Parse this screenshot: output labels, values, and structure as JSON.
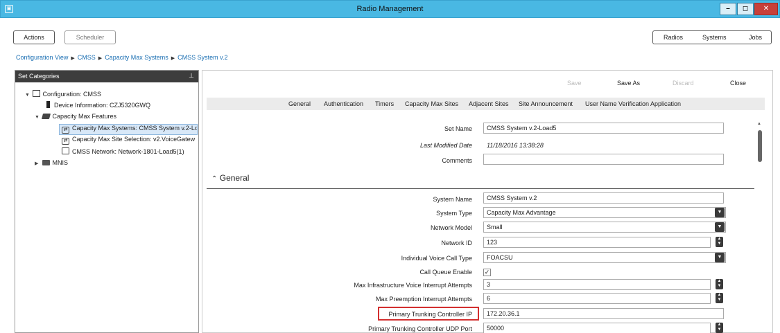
{
  "window": {
    "title": "Radio Management",
    "app_icon": "app-icon",
    "minimize": "–",
    "maximize": "◻",
    "close": "✕"
  },
  "topbar": {
    "actions": "Actions",
    "scheduler": "Scheduler",
    "nav": {
      "radios": "Radios",
      "systems": "Systems",
      "jobs": "Jobs"
    }
  },
  "breadcrumb": [
    "Configuration View",
    "CMSS",
    "Capacity Max Systems",
    "CMSS System v.2"
  ],
  "sidebar": {
    "header": "Set Categories",
    "items": [
      {
        "label": "Configuration: CMSS",
        "icon": "config-icon"
      },
      {
        "label": "Device Information: CZJ5320GWQ",
        "icon": "device-icon"
      },
      {
        "label": "Capacity Max Features",
        "icon": "folder-open-icon"
      },
      {
        "label": "Capacity Max Systems: CMSS System v.2-Lo",
        "icon": "link-icon"
      },
      {
        "label": "Capacity Max Site Selection: v2.VoiceGatew",
        "icon": "link-icon"
      },
      {
        "label": "CMSS Network: Network-1801-Load5(1)",
        "icon": "doc-icon"
      },
      {
        "label": "MNIS",
        "icon": "folder-icon"
      }
    ]
  },
  "toolbar": {
    "save": "Save",
    "save_as": "Save As",
    "discard": "Discard",
    "close": "Close"
  },
  "tabs": [
    "General",
    "Authentication",
    "Timers",
    "Capacity Max Sites",
    "Adjacent Sites",
    "Site Announcement",
    "User Name Verification Application"
  ],
  "header_fields": {
    "set_name_label": "Set Name",
    "set_name_value": "CMSS System v.2-Load5",
    "last_modified_label": "Last Modified Date",
    "last_modified_value": "11/18/2016 13:38:28",
    "comments_label": "Comments",
    "comments_value": ""
  },
  "section": {
    "title": "General",
    "chevron": "⌃"
  },
  "general": {
    "system_name_label": "System Name",
    "system_name_value": "CMSS System v.2",
    "system_type_label": "System Type",
    "system_type_value": "Capacity Max Advantage",
    "network_model_label": "Network Model",
    "network_model_value": "Small",
    "network_id_label": "Network ID",
    "network_id_value": "123",
    "ivc_type_label": "Individual Voice Call Type",
    "ivc_type_value": "FOACSU",
    "call_queue_label": "Call Queue Enable",
    "call_queue_checked": "✓",
    "max_infra_label": "Max Infrastructure Voice Interrupt Attempts",
    "max_infra_value": "3",
    "max_preempt_label": "Max Preemption Interrupt Attempts",
    "max_preempt_value": "6",
    "ptc_ip_label": "Primary Trunking Controller IP",
    "ptc_ip_value": "172.20.36.1",
    "ptc_udp_label": "Primary Trunking Controller UDP Port",
    "ptc_udp_value": "50000"
  },
  "colors": {
    "titlebar": "#49b8e3",
    "link": "#1b6fb3",
    "highlight": "#d32f2f"
  }
}
